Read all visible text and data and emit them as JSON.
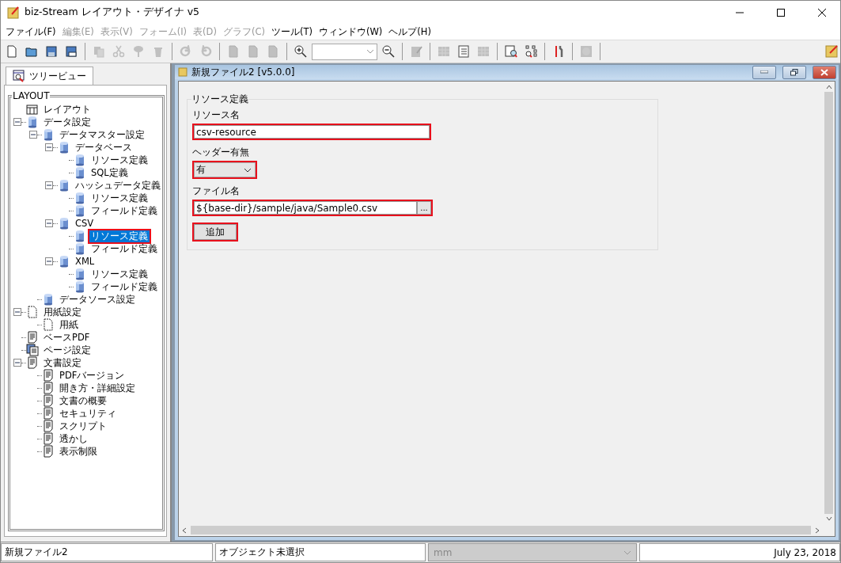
{
  "window": {
    "title": "biz-Stream レイアウト・デザイナ v5"
  },
  "menu": [
    {
      "label": "ファイル(F)",
      "disabled": false
    },
    {
      "label": "編集(E)",
      "disabled": true
    },
    {
      "label": "表示(V)",
      "disabled": true
    },
    {
      "label": "フォーム(I)",
      "disabled": true
    },
    {
      "label": "表(D)",
      "disabled": true
    },
    {
      "label": "グラフ(C)",
      "disabled": true
    },
    {
      "label": "ツール(T)",
      "disabled": false
    },
    {
      "label": "ウィンドウ(W)",
      "disabled": false
    },
    {
      "label": "ヘルプ(H)",
      "disabled": false
    }
  ],
  "toolbar": [
    {
      "kind": "new",
      "disabled": false
    },
    {
      "kind": "open",
      "disabled": false
    },
    {
      "kind": "save",
      "disabled": false
    },
    {
      "kind": "saveas",
      "disabled": false
    },
    {
      "kind": "sep"
    },
    {
      "kind": "copy",
      "disabled": true
    },
    {
      "kind": "cut",
      "disabled": true
    },
    {
      "kind": "pin",
      "disabled": true
    },
    {
      "kind": "trash",
      "disabled": true
    },
    {
      "kind": "sep"
    },
    {
      "kind": "redo",
      "disabled": true
    },
    {
      "kind": "undo",
      "disabled": true
    },
    {
      "kind": "sep"
    },
    {
      "kind": "page",
      "disabled": true
    },
    {
      "kind": "page",
      "disabled": true
    },
    {
      "kind": "page",
      "disabled": true
    },
    {
      "kind": "sep"
    },
    {
      "kind": "zoomin",
      "disabled": false
    },
    {
      "kind": "zoombox"
    },
    {
      "kind": "zoomout",
      "disabled": false
    },
    {
      "kind": "sep"
    },
    {
      "kind": "edit",
      "disabled": true
    },
    {
      "kind": "sep"
    },
    {
      "kind": "grid",
      "disabled": true
    },
    {
      "kind": "text",
      "disabled": false
    },
    {
      "kind": "grid",
      "disabled": true
    },
    {
      "kind": "sep"
    },
    {
      "kind": "preview",
      "disabled": false
    },
    {
      "kind": "treesearch",
      "disabled": false
    },
    {
      "kind": "sep"
    },
    {
      "kind": "tools",
      "disabled": false
    },
    {
      "kind": "sep"
    },
    {
      "kind": "circle",
      "disabled": true
    },
    {
      "kind": "sep"
    }
  ],
  "left_panel": {
    "tab": {
      "label": "ツリービュー",
      "selected": true
    },
    "group_title": "LAYOUT",
    "tree": [
      {
        "label": "レイアウト",
        "kind": "layout",
        "selected": false,
        "highlighted": false
      },
      {
        "label": "データ設定",
        "kind": "db",
        "expanded": true,
        "selected": false,
        "highlighted": false,
        "children": [
          {
            "label": "データマスター設定",
            "kind": "db",
            "expanded": true,
            "selected": false,
            "highlighted": false,
            "children": [
              {
                "label": "データベース",
                "kind": "db",
                "expanded": true,
                "selected": false,
                "highlighted": false,
                "children": [
                  {
                    "label": "リソース定義",
                    "kind": "db",
                    "selected": false,
                    "highlighted": false
                  },
                  {
                    "label": "SQL定義",
                    "kind": "db",
                    "selected": false,
                    "highlighted": false
                  }
                ]
              },
              {
                "label": "ハッシュデータ定義",
                "kind": "db",
                "expanded": true,
                "selected": false,
                "highlighted": false,
                "children": [
                  {
                    "label": "リソース定義",
                    "kind": "db",
                    "selected": false,
                    "highlighted": false
                  },
                  {
                    "label": "フィールド定義",
                    "kind": "db",
                    "selected": false,
                    "highlighted": false
                  }
                ]
              },
              {
                "label": "CSV",
                "kind": "db",
                "expanded": true,
                "selected": false,
                "highlighted": false,
                "children": [
                  {
                    "label": "リソース定義",
                    "kind": "db",
                    "selected": true,
                    "highlighted": true
                  },
                  {
                    "label": "フィールド定義",
                    "kind": "db",
                    "selected": false,
                    "highlighted": false
                  }
                ]
              },
              {
                "label": "XML",
                "kind": "db",
                "expanded": true,
                "selected": false,
                "highlighted": false,
                "children": [
                  {
                    "label": "リソース定義",
                    "kind": "db",
                    "selected": false,
                    "highlighted": false
                  },
                  {
                    "label": "フィールド定義",
                    "kind": "db",
                    "selected": false,
                    "highlighted": false
                  }
                ]
              }
            ]
          },
          {
            "label": "データソース設定",
            "kind": "db",
            "selected": false,
            "highlighted": false
          }
        ]
      },
      {
        "label": "用紙設定",
        "kind": "paper",
        "expanded": true,
        "selected": false,
        "highlighted": false,
        "children": [
          {
            "label": "用紙",
            "kind": "paper",
            "selected": false,
            "highlighted": false
          }
        ]
      },
      {
        "label": "ベースPDF",
        "kind": "doc",
        "selected": false,
        "highlighted": false
      },
      {
        "label": "ページ設定",
        "kind": "pages",
        "selected": false,
        "highlighted": false
      },
      {
        "label": "文書設定",
        "kind": "doc",
        "expanded": true,
        "selected": false,
        "highlighted": false,
        "children": [
          {
            "label": "PDFバージョン",
            "kind": "doc",
            "selected": false,
            "highlighted": false
          },
          {
            "label": "開き方・詳細設定",
            "kind": "doc",
            "selected": false,
            "highlighted": false
          },
          {
            "label": "文書の概要",
            "kind": "doc",
            "selected": false,
            "highlighted": false
          },
          {
            "label": "セキュリティ",
            "kind": "doc",
            "selected": false,
            "highlighted": false
          },
          {
            "label": "スクリプト",
            "kind": "doc",
            "selected": false,
            "highlighted": false
          },
          {
            "label": "透かし",
            "kind": "doc",
            "selected": false,
            "highlighted": false
          },
          {
            "label": "表示制限",
            "kind": "doc",
            "selected": false,
            "highlighted": false
          }
        ]
      }
    ]
  },
  "document": {
    "title": "新規ファイル2 [v5.0.0]",
    "group_title": "リソース定義",
    "fields": [
      {
        "kind": "text",
        "label": "リソース名",
        "value": "csv-resource",
        "highlighted": true
      },
      {
        "kind": "select",
        "label": "ヘッダー有無",
        "value": "有",
        "highlighted": true
      },
      {
        "kind": "file",
        "label": "ファイル名",
        "value": "${base-dir}/sample/java/Sample0.csv",
        "browse": "...",
        "highlighted": true
      },
      {
        "kind": "button",
        "label": "追加",
        "highlighted": true
      }
    ]
  },
  "status_bar": {
    "file": "新規ファイル2",
    "selection": "オブジェクト未選択",
    "unit": "mm",
    "unit_disabled": true,
    "date": "July 23, 2018"
  }
}
